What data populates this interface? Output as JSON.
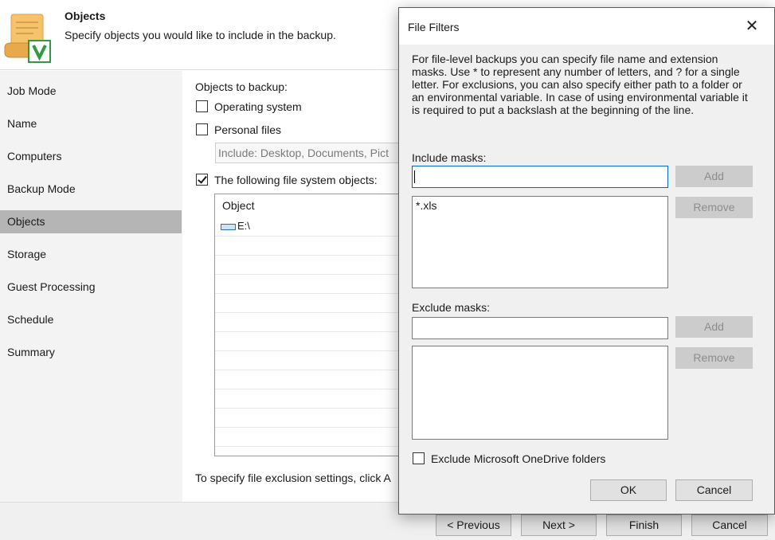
{
  "header": {
    "title": "Objects",
    "subtitle": "Specify objects you would like to include in the backup.",
    "icon": "scroll-checkmark-icon"
  },
  "nav": {
    "items": [
      {
        "label": "Job Mode"
      },
      {
        "label": "Name"
      },
      {
        "label": "Computers"
      },
      {
        "label": "Backup Mode"
      },
      {
        "label": "Objects",
        "active": true
      },
      {
        "label": "Storage"
      },
      {
        "label": "Guest Processing"
      },
      {
        "label": "Schedule"
      },
      {
        "label": "Summary"
      }
    ],
    "active_color": "#b5b5b5"
  },
  "main": {
    "objects_label": "Objects to backup:",
    "operating_system": {
      "label": "Operating system",
      "checked": false
    },
    "personal_files": {
      "label": "Personal files",
      "checked": false
    },
    "include_field": "Include: Desktop, Documents, Pict",
    "file_system": {
      "label": "The following file system objects:",
      "checked": true
    },
    "table": {
      "header": "Object",
      "rows": [
        {
          "icon": "drive-icon",
          "label": "E:\\"
        }
      ]
    },
    "exclusion_hint": "To specify file exclusion settings, click A"
  },
  "footer": {
    "previous": "< Previous",
    "next": "Next >",
    "finish": "Finish",
    "cancel": "Cancel"
  },
  "dialog": {
    "title": "File Filters",
    "close_icon": "close-icon",
    "description": "For file-level backups you can specify file name and extension masks. Use * to represent any number of letters, and ? for a single letter. For exclusions, you can also specify either path to a folder or an environmental variable. In case of using environmental variable it is required to put a backslash at the beginning of the line.",
    "include": {
      "label": "Include masks:",
      "value": "",
      "add": "Add",
      "remove": "Remove",
      "items": [
        "*.xls"
      ]
    },
    "exclude": {
      "label": "Exclude masks:",
      "value": "",
      "add": "Add",
      "remove": "Remove",
      "items": []
    },
    "onedrive": {
      "label": "Exclude Microsoft OneDrive folders",
      "checked": false
    },
    "ok": "OK",
    "cancel": "Cancel"
  },
  "colors": {
    "accent": "#0a64c8",
    "disabled_button": "#cccccc",
    "dialog_background": "#f0f0f0"
  }
}
